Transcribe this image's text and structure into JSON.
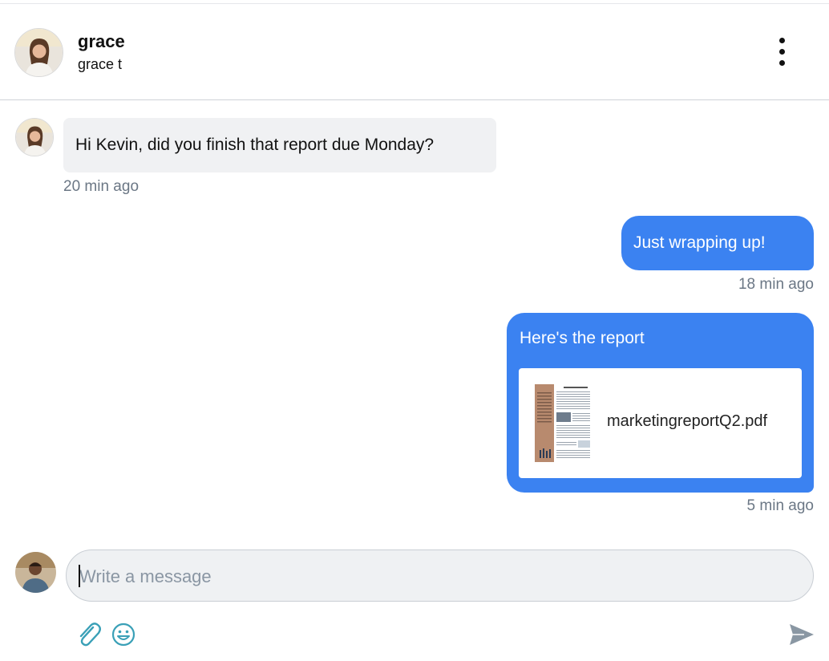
{
  "header": {
    "name": "grace",
    "username": "grace t",
    "menu_icon": "more-vertical-icon"
  },
  "messages": [
    {
      "direction": "incoming",
      "text": "Hi Kevin, did you finish that report due Monday?",
      "time": "20 min ago"
    },
    {
      "direction": "outgoing",
      "text": "Just wrapping up!",
      "time": "18 min ago"
    },
    {
      "direction": "outgoing",
      "text": "Here's the report",
      "attachment": {
        "filename": "marketingreportQ2.pdf",
        "icon": "pdf-thumbnail"
      },
      "time": "5 min ago"
    }
  ],
  "composer": {
    "placeholder": "Write a message",
    "value": "",
    "attach_icon": "paperclip-icon",
    "emoji_icon": "smiley-icon",
    "send_icon": "send-icon"
  },
  "colors": {
    "accent": "#3b82f1",
    "incoming_bubble": "#f0f1f3",
    "timestamp": "#6b7785",
    "icon_teal": "#3aa0b7",
    "send_gray": "#8a97a3"
  }
}
